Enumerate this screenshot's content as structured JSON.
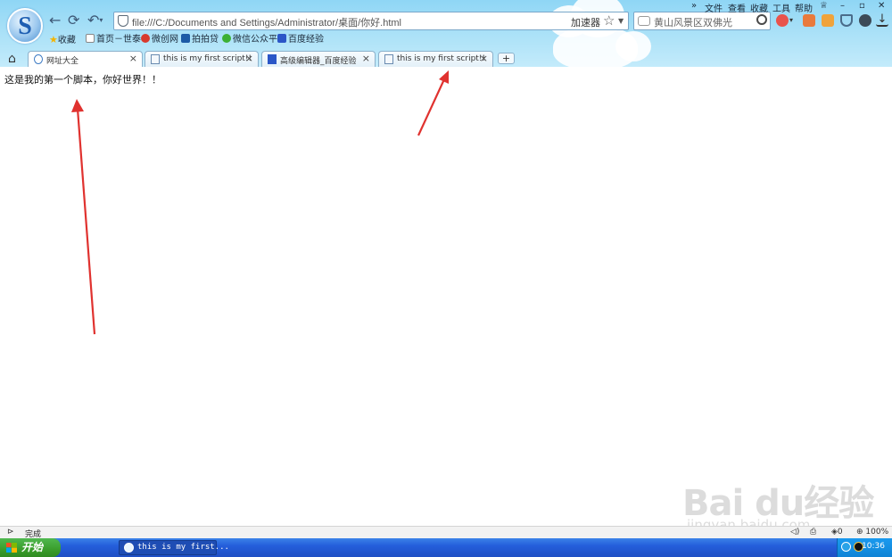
{
  "menubar": {
    "overflow": "»",
    "file": "文件",
    "view": "查看",
    "favorites": "收藏",
    "tools": "工具",
    "help": "帮助"
  },
  "window_controls": {
    "minimize": "–",
    "restore": "▫",
    "close": "✕"
  },
  "address_bar": {
    "url": "file:///C:/Documents and Settings/Administrator/桌面/你好.html",
    "accelerator_label": "加速器",
    "favorite_star": "☆"
  },
  "search": {
    "query": "黄山风景区双佛光"
  },
  "bookmarks": [
    {
      "label": "收藏",
      "icon": "star-icon",
      "color": "#f4b400"
    },
    {
      "label": "首页－世泰",
      "icon": "page-icon",
      "color": "#ffffff"
    },
    {
      "label": "微创网",
      "icon": "weichuang-icon",
      "color": "#d83a2e"
    },
    {
      "label": "拍拍贷",
      "icon": "paipaidai-icon",
      "color": "#1b5aa6"
    },
    {
      "label": "微信公众平",
      "icon": "wechat-icon",
      "color": "#3cb034"
    },
    {
      "label": "百度经验",
      "icon": "baidu-paw-icon",
      "color": "#2b56c7"
    }
  ],
  "tabs": [
    {
      "label": "网址大全",
      "icon": "globe-icon",
      "active": true
    },
    {
      "label": "this is my first script!!",
      "icon": "page-icon",
      "active": false
    },
    {
      "label": "高级编辑器_百度经验",
      "icon": "baidu-paw-icon",
      "active": false
    },
    {
      "label": "this is my first script!!",
      "icon": "page-icon",
      "active": false
    }
  ],
  "new_tab_label": "+",
  "page": {
    "text": "这是我的第一个脚本，你好世界！！"
  },
  "watermark": {
    "brand": "Bai du经验",
    "url": "jingyan.baidu.com"
  },
  "statusbar": {
    "status": "完成",
    "security_count": "0",
    "zoom": "100%"
  },
  "taskbar": {
    "start_label": "开始",
    "task_label": "this is my first...",
    "clock": "10:36"
  },
  "colors": {
    "chrome_sky": "#a8e0f7",
    "arrow_red": "#e0322f",
    "taskbar_blue": "#245edb",
    "start_green": "#3a9d2c"
  }
}
